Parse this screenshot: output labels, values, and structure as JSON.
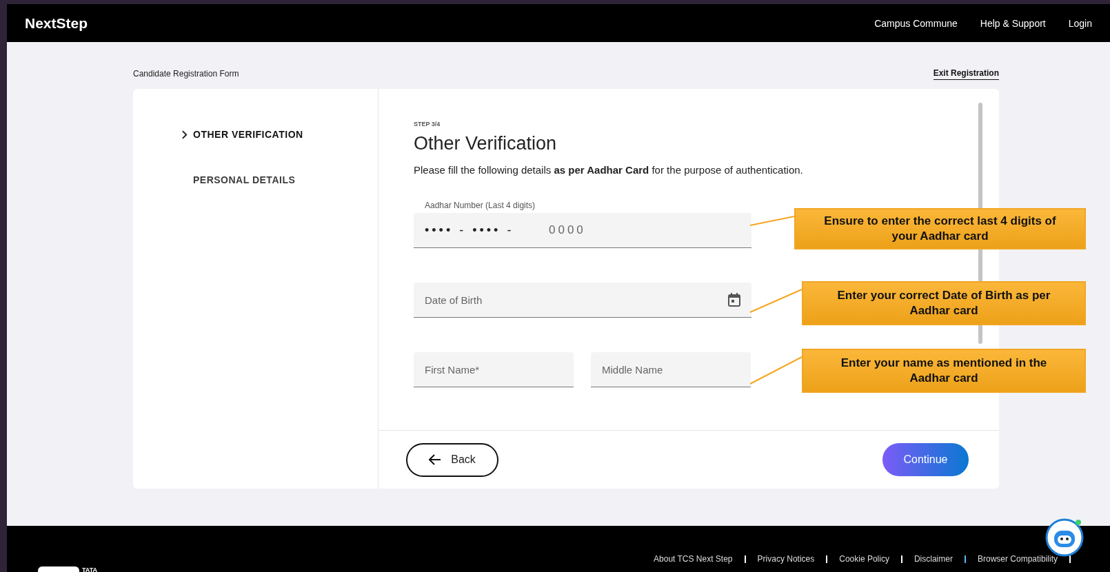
{
  "header": {
    "logo": "NextStep",
    "nav": [
      "Campus Commune",
      "Help & Support",
      "Login"
    ]
  },
  "form_title": "Candidate Registration Form",
  "exit_link": "Exit Registration",
  "steps": [
    {
      "label": "OTHER VERIFICATION",
      "selected": true
    },
    {
      "label": "PERSONAL DETAILS",
      "selected": false
    }
  ],
  "step_label": "STEP 3/4",
  "heading": "Other Verification",
  "instruction": "Please fill the following details **as per Aadhar Card** for the purpose of authentication.",
  "fields": [
    {
      "kind": "masked",
      "label": "Aadhar Number (Last 4 digits)",
      "mask": "•••• - •••• -",
      "placeholder": "0000"
    },
    {
      "kind": "date",
      "placeholder": "Date of Birth"
    },
    {
      "kind": "pair",
      "items": [
        {
          "placeholder": "First Name*"
        },
        {
          "placeholder": "Middle Name"
        }
      ]
    }
  ],
  "buttons": {
    "back": "Back",
    "continue": "Continue"
  },
  "callouts": [
    "Ensure to enter the correct last 4 digits of your Aadhar card",
    "Enter your correct Date of Birth as per Aadhar card",
    "Enter your name as mentioned in the Aadhar card"
  ],
  "footer": {
    "logo": "TATA",
    "links": [
      "About TCS Next Step",
      "Privacy Notices",
      "Cookie Policy",
      "Disclaimer",
      "Browser Compatibility"
    ]
  }
}
